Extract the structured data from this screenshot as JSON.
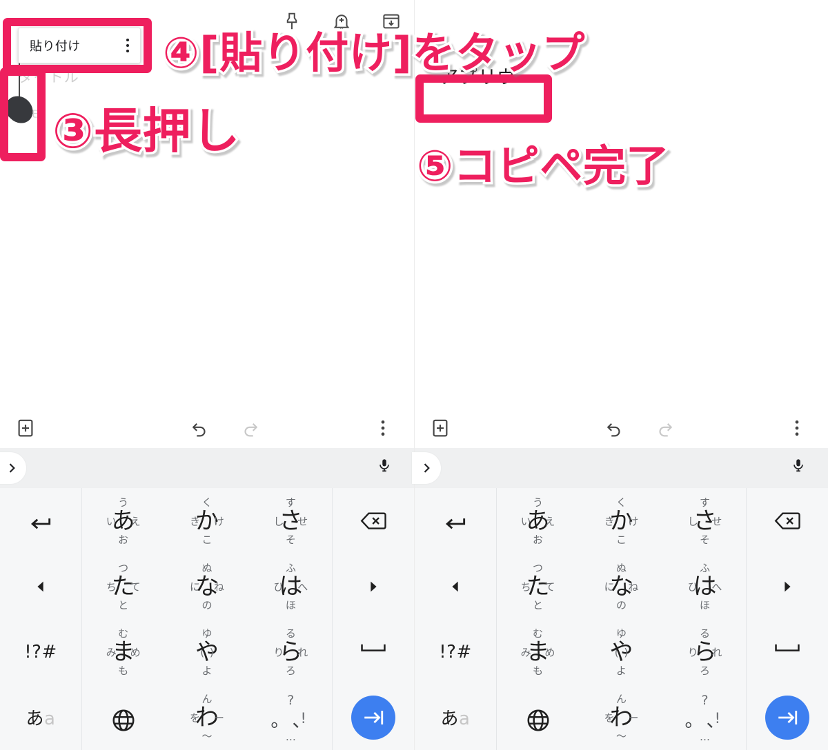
{
  "meta": {
    "accent_pink": "#ee1f5e",
    "enter_blue": "#3d7ff0",
    "keyboard_bg": "#f6f7f8",
    "suggestion_bg": "#eff0f1"
  },
  "app_bar": {
    "icons": [
      {
        "name": "pin-icon",
        "label": "固定"
      },
      {
        "name": "reminder-bell-icon",
        "label": "リマインダー"
      },
      {
        "name": "archive-icon",
        "label": "アーカイブ"
      }
    ]
  },
  "note": {
    "title_placeholder": "タイトル",
    "body_placeholder": "メモ",
    "pasted_text": "アプリヴ"
  },
  "paste_popup": {
    "label": "貼り付け",
    "overflow_icon": "more-vert-icon"
  },
  "keyboard_toolbar": {
    "add_icon": "add-box-icon",
    "undo_icon": "undo-icon",
    "redo_icon": "redo-icon",
    "redo_disabled": true,
    "overflow_icon": "more-vert-icon"
  },
  "suggestion_bar": {
    "expand_icon": "chevron-right-icon",
    "mic_icon": "microphone-icon",
    "suggestions": []
  },
  "keyboard": {
    "rows": [
      [
        {
          "type": "icon",
          "name": "key-enter-newline",
          "icon": "arrow-return-icon"
        },
        {
          "type": "flick",
          "name": "key-a",
          "center": "あ",
          "up": "う",
          "down": "お",
          "left": "い",
          "right": "え"
        },
        {
          "type": "flick",
          "name": "key-ka",
          "center": "か",
          "up": "く",
          "down": "こ",
          "left": "き",
          "right": "け"
        },
        {
          "type": "flick",
          "name": "key-sa",
          "center": "さ",
          "up": "す",
          "down": "そ",
          "left": "し",
          "right": "せ"
        },
        {
          "type": "icon",
          "name": "key-backspace",
          "icon": "backspace-icon"
        }
      ],
      [
        {
          "type": "icon",
          "name": "key-cursor-left",
          "icon": "triangle-left-icon"
        },
        {
          "type": "flick",
          "name": "key-ta",
          "center": "た",
          "up": "つ",
          "down": "と",
          "left": "ち",
          "right": "て"
        },
        {
          "type": "flick",
          "name": "key-na",
          "center": "な",
          "up": "ぬ",
          "down": "の",
          "left": "に",
          "right": "ね"
        },
        {
          "type": "flick",
          "name": "key-ha",
          "center": "は",
          "up": "ふ",
          "down": "ほ",
          "left": "ひ",
          "right": "へ"
        },
        {
          "type": "icon",
          "name": "key-cursor-right",
          "icon": "triangle-right-icon"
        }
      ],
      [
        {
          "type": "label",
          "name": "key-symbols",
          "label": "!?#"
        },
        {
          "type": "flick",
          "name": "key-ma",
          "center": "ま",
          "up": "む",
          "down": "も",
          "left": "み",
          "right": "め"
        },
        {
          "type": "flick",
          "name": "key-ya",
          "center": "や",
          "up": "ゆ",
          "down": "よ",
          "left": "(",
          "right": ")"
        },
        {
          "type": "flick",
          "name": "key-ra",
          "center": "ら",
          "up": "る",
          "down": "ろ",
          "left": "り",
          "right": "れ"
        },
        {
          "type": "icon",
          "name": "key-space",
          "icon": "space-bar-icon"
        }
      ],
      [
        {
          "type": "label2",
          "name": "key-input-mode",
          "label": "あ",
          "label_dim": "a"
        },
        {
          "type": "icon",
          "name": "key-language-globe",
          "icon": "globe-icon"
        },
        {
          "type": "flick",
          "name": "key-wa",
          "center": "わ",
          "up": "ん",
          "down": "〜",
          "left": "を",
          "right": "ー"
        },
        {
          "type": "punct",
          "name": "key-punctuation",
          "up": "?",
          "center_left": "。",
          "center_right": "、",
          "right": "!",
          "down": "…"
        },
        {
          "type": "enter",
          "name": "key-enter",
          "icon": "tab-next-icon"
        }
      ]
    ]
  },
  "annotations": [
    {
      "name": "annotation-step-4",
      "text": "④[貼り付け]をタップ"
    },
    {
      "name": "annotation-step-3",
      "text": "③長押し"
    },
    {
      "name": "annotation-step-5",
      "text": "⑤コピペ完了"
    }
  ]
}
